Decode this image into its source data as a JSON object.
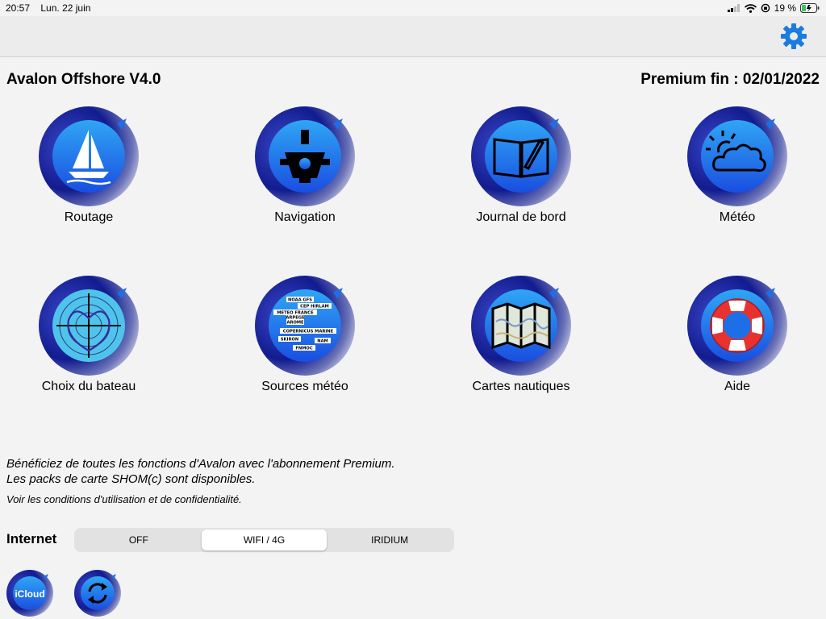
{
  "status": {
    "time": "20:57",
    "date": "Lun. 22 juin",
    "battery": "19 %"
  },
  "header": {
    "app_title": "Avalon Offshore V4.0",
    "premium": "Premium fin : 02/01/2022",
    "settings_icon": "gear-icon"
  },
  "tiles": [
    {
      "label": "Routage",
      "icon": "sailboat-icon"
    },
    {
      "label": "Navigation",
      "icon": "sextant-icon"
    },
    {
      "label": "Journal de bord",
      "icon": "logbook-icon"
    },
    {
      "label": "Météo",
      "icon": "weather-icon"
    },
    {
      "label": "Choix du bateau",
      "icon": "polar-diagram-icon"
    },
    {
      "label": "Sources météo",
      "icon": "weather-sources-icon"
    },
    {
      "label": "Cartes nautiques",
      "icon": "nautical-map-icon"
    },
    {
      "label": "Aide",
      "icon": "lifebuoy-icon"
    }
  ],
  "weather_sources": [
    "NOAA GFS",
    "CEP HIRLAM",
    "METEO FRANCE",
    "ARPEGE",
    "AROME",
    "COPERNICUS MARINE",
    "SKIRON",
    "NAM",
    "FNMOC"
  ],
  "notes": {
    "line1": "Bénéficiez de toutes les fonctions d'Avalon avec l'abonnement Premium.",
    "line2": "Les packs de carte SHOM(c) sont disponibles.",
    "line3": "Voir les conditions d'utilisation et de confidentialité."
  },
  "internet": {
    "label": "Internet",
    "options": [
      "OFF",
      "WIFI / 4G",
      "IRIDIUM"
    ],
    "selected": "WIFI / 4G"
  },
  "bottom_buttons": {
    "icloud_label": "iCloud",
    "sync_icon": "sync-icon"
  },
  "colors": {
    "accent": "#1a7ce0",
    "icon_blue": "#1d6fe8",
    "ring_dark": "#131a8a"
  }
}
